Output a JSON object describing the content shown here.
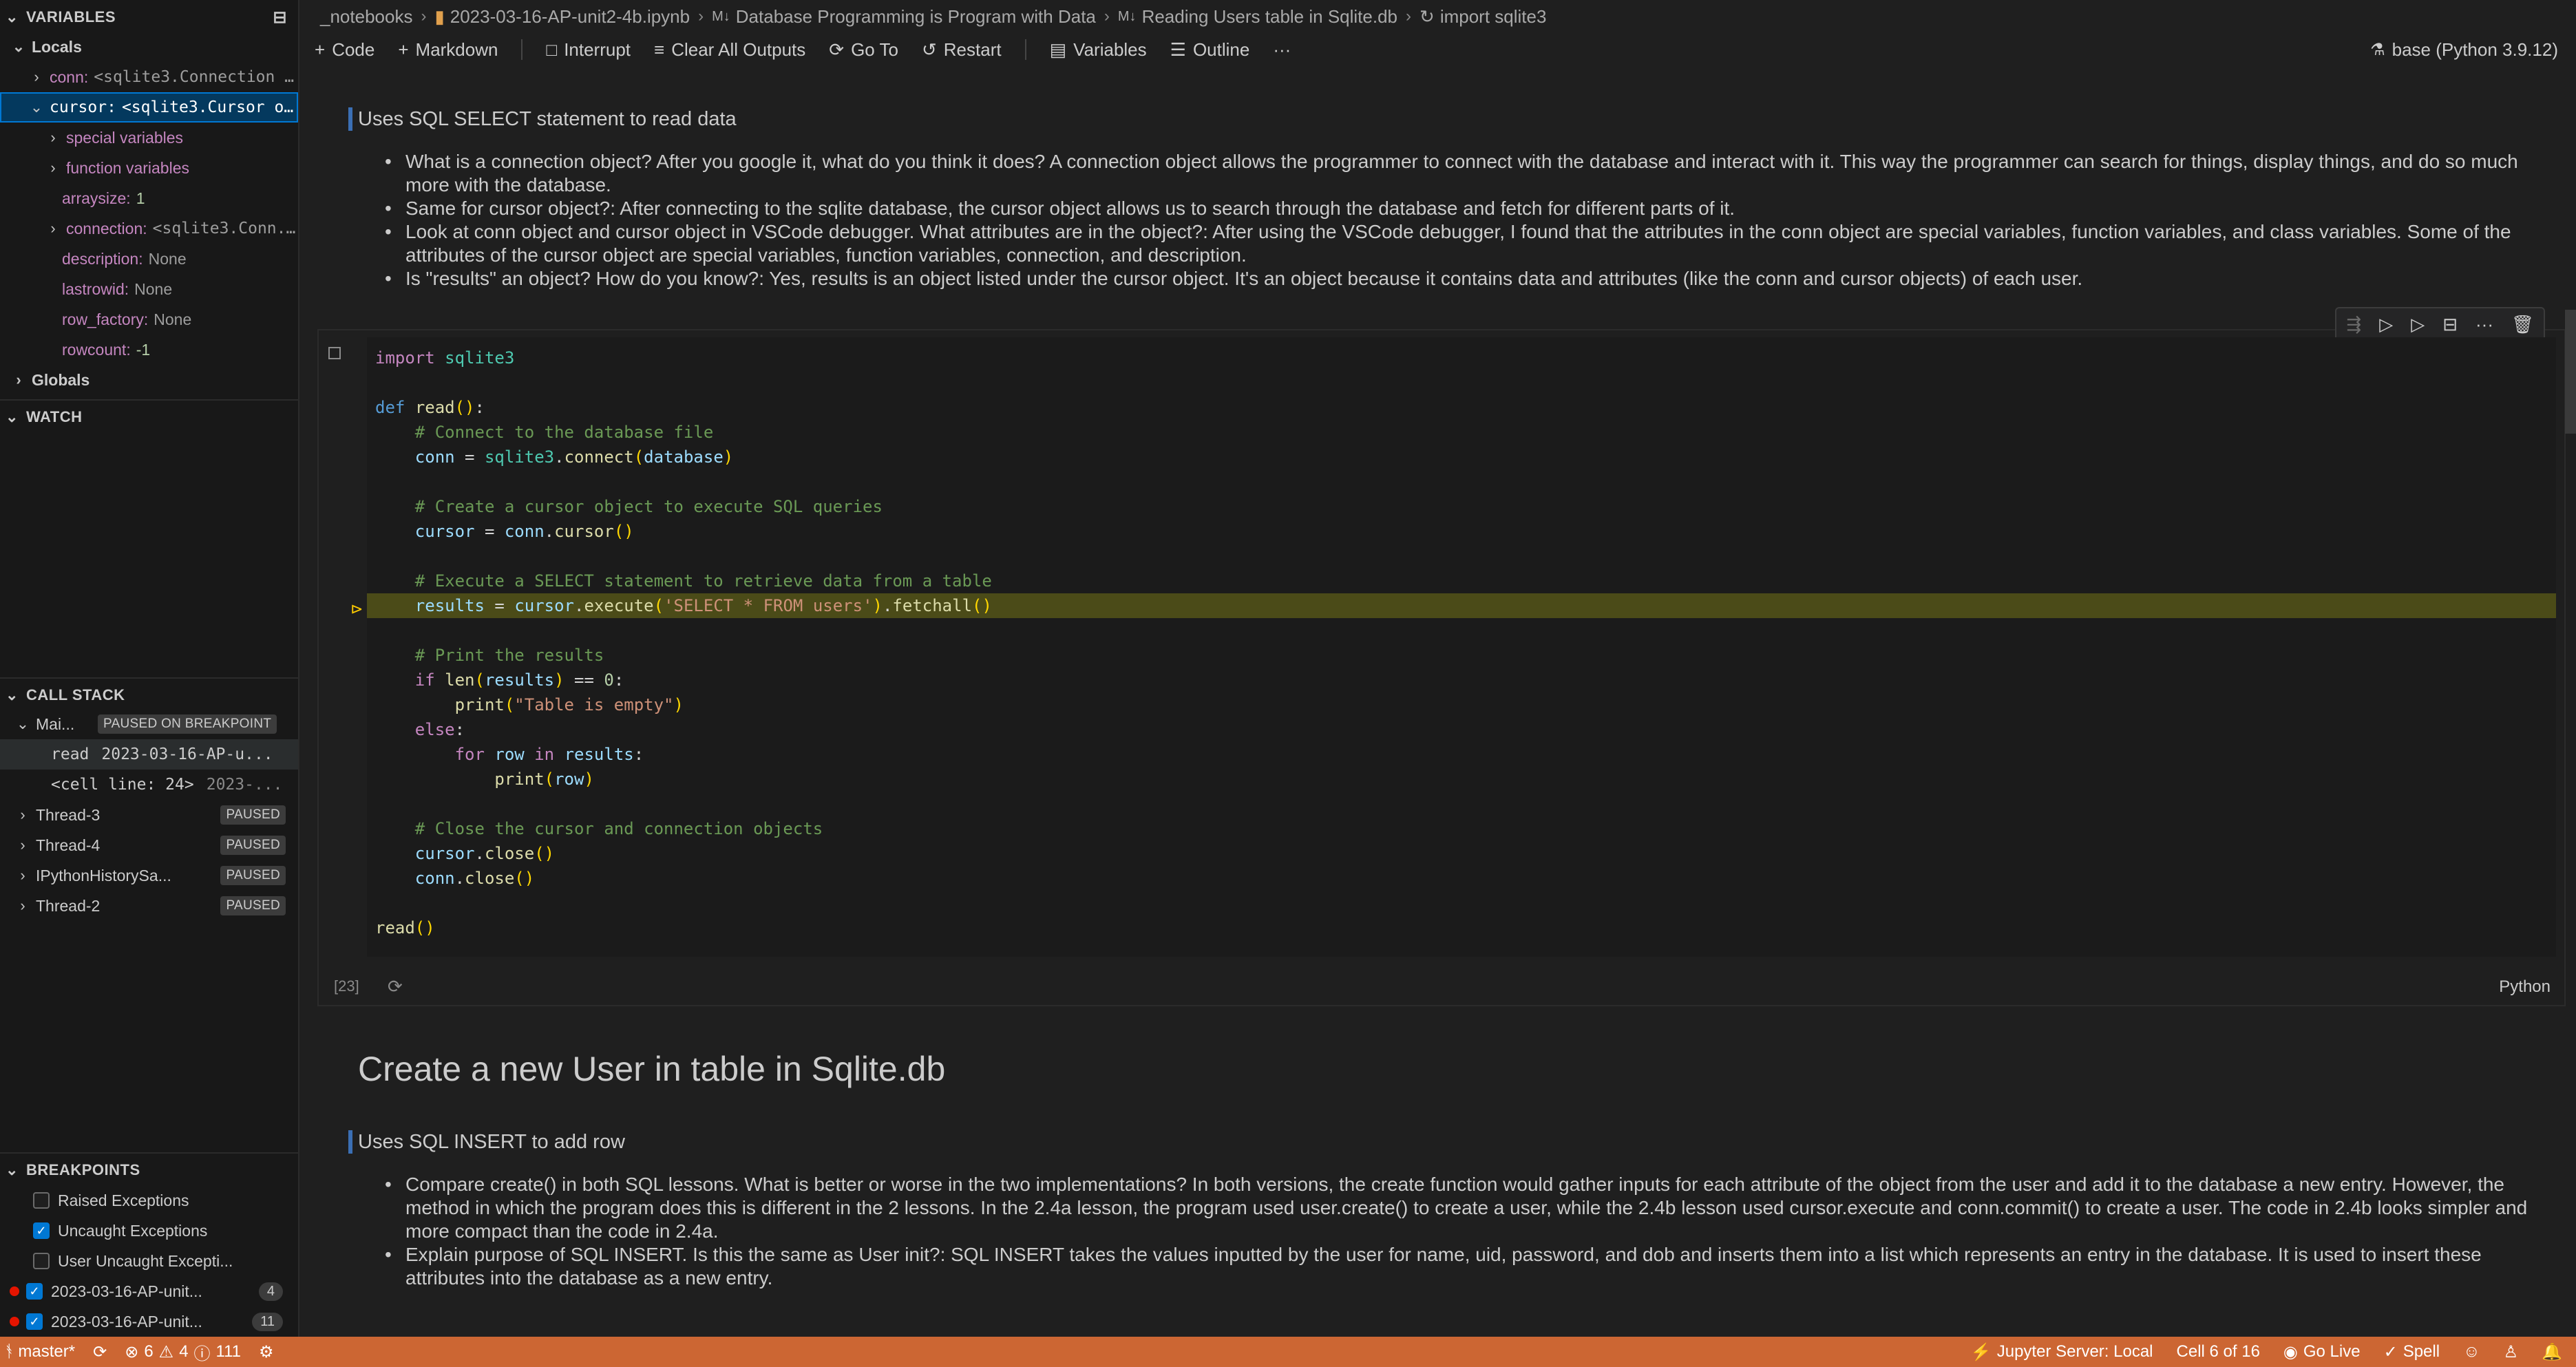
{
  "sidebar": {
    "variables_title": "VARIABLES",
    "locals_title": "Locals",
    "globals_title": "Globals",
    "watch_title": "WATCH",
    "callstack_title": "CALL STACK",
    "breakpoints_title": "BREAKPOINTS",
    "locals": [
      {
        "name": "conn:",
        "value": "<sqlite3.Connection ..."
      },
      {
        "name": "cursor:",
        "value": "<sqlite3.Cursor o..."
      }
    ],
    "cursor_children": [
      {
        "name": "special variables",
        "value": ""
      },
      {
        "name": "function variables",
        "value": ""
      },
      {
        "name": "arraysize:",
        "value": "1"
      },
      {
        "name": "connection:",
        "value": "<sqlite3.Conn..."
      },
      {
        "name": "description:",
        "value": "None"
      },
      {
        "name": "lastrowid:",
        "value": "None"
      },
      {
        "name": "row_factory:",
        "value": "None"
      },
      {
        "name": "rowcount:",
        "value": "-1"
      }
    ],
    "callstack": {
      "main": {
        "label": "Mai...",
        "badge": "PAUSED ON BREAKPOINT"
      },
      "frames": [
        {
          "fn": "read",
          "file": "2023-03-16-AP-u..."
        },
        {
          "fn": "<cell line: 24>",
          "file": "2023-..."
        }
      ],
      "threads": [
        {
          "name": "Thread-3",
          "badge": "PAUSED"
        },
        {
          "name": "Thread-4",
          "badge": "PAUSED"
        },
        {
          "name": "IPythonHistorySa...",
          "badge": "PAUSED"
        },
        {
          "name": "Thread-2",
          "badge": "PAUSED"
        }
      ]
    },
    "breakpoints": [
      {
        "label": "Raised Exceptions",
        "checked": false
      },
      {
        "label": "Uncaught Exceptions",
        "checked": true
      },
      {
        "label": "User Uncaught Excepti...",
        "checked": false
      }
    ],
    "breakpoint_files": [
      {
        "label": "2023-03-16-AP-unit...",
        "count": "4"
      },
      {
        "label": "2023-03-16-AP-unit...",
        "count": "11"
      }
    ]
  },
  "breadcrumb": {
    "folder": "_notebooks",
    "file": "2023-03-16-AP-unit2-4b.ipynb",
    "md_prefix": "M↓",
    "section1": "Database Programming is Program with Data",
    "section2": "Reading Users table in Sqlite.db",
    "cell": "import sqlite3"
  },
  "toolbar": {
    "code": "Code",
    "markdown": "Markdown",
    "interrupt": "Interrupt",
    "clear": "Clear All Outputs",
    "goto": "Go To",
    "restart": "Restart",
    "variables": "Variables",
    "outline": "Outline",
    "more": "···",
    "kernel": "base (Python 3.9.12)"
  },
  "notebook": {
    "md1_heading": "Uses SQL SELECT statement to read data",
    "md1_bullets": [
      "What is a connection object? After you google it, what do you think it does? A connection object allows the programmer to connect with the database and interact with it. This way the programmer can search for things, display things, and do so much more with the database.",
      "Same for cursor object?: After connecting to the sqlite database, the cursor object allows us to search through the database and fetch for different parts of it.",
      "Look at conn object and cursor object in VSCode debugger. What attributes are in the object?: After using the VSCode debugger, I found that the attributes in the conn object are special variables, function variables, and class variables. Some of the attributes of the cursor object are special variables, function variables, connection, and description.",
      "Is \"results\" an object? How do you know?: Yes, results is an object listed under the cursor object. It's an object because it contains data and attributes (like the conn and cursor objects) of each user."
    ],
    "exec_count": "[23]",
    "language": "Python",
    "h2": "Create a new User in table in Sqlite.db",
    "md2_heading": "Uses SQL INSERT to add row",
    "md2_bullets": [
      "Compare create() in both SQL lessons. What is better or worse in the two implementations? In both versions, the create function would gather inputs for each attribute of the object from the user and add it to the database a new entry. However, the method in which the program does this is different in the 2 lessons. In the 2.4a lesson, the program used user.create() to create a user, while the 2.4b lesson used cursor.execute and conn.commit() to create a user. The code in 2.4b looks simpler and more compact than the code in 2.4a.",
      "Explain purpose of SQL INSERT. Is this the same as User init?: SQL INSERT takes the values inputted by the user for name, uid, password, and dob and inserts them into a list which represents an entry in the database. It is used to insert these attributes into the database as a new entry."
    ],
    "code_lines": [
      "import sqlite3",
      "",
      "def read():",
      "    # Connect to the database file",
      "    conn = sqlite3.connect(database)",
      "",
      "    # Create a cursor object to execute SQL queries",
      "    cursor = conn.cursor()",
      "",
      "    # Execute a SELECT statement to retrieve data from a table",
      "    results = cursor.execute('SELECT * FROM users').fetchall()",
      "",
      "    # Print the results",
      "    if len(results) == 0:",
      "        print(\"Table is empty\")",
      "    else:",
      "        for row in results:",
      "            print(row)",
      "",
      "    # Close the cursor and connection objects",
      "    cursor.close()",
      "    conn.close()",
      "",
      "read()"
    ]
  },
  "statusbar": {
    "branch": "master*",
    "errors": "6",
    "warnings": "4",
    "info": "111",
    "jupyter": "Jupyter Server: Local",
    "cell": "Cell 6 of 16",
    "golive": "Go Live",
    "spell": "Spell"
  },
  "colors": {
    "accent": "#0078d4",
    "statusbar": "#cc6633",
    "highlight_line": "#4b4b18"
  }
}
